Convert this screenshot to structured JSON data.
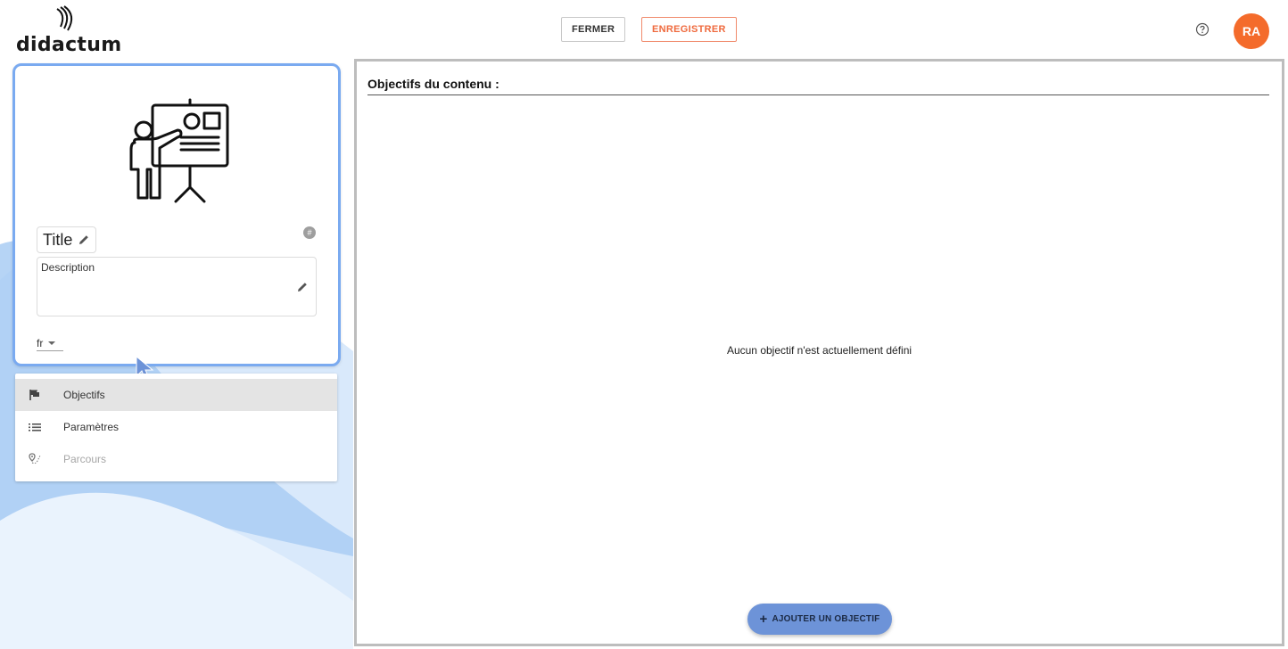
{
  "header": {
    "logo_text": "didactum",
    "close_label": "FERMER",
    "save_label": "ENREGISTRER",
    "avatar_initials": "RA"
  },
  "card": {
    "title": "Title",
    "description_label": "Description",
    "language": "fr",
    "id_badge": "#"
  },
  "nav": {
    "items": [
      {
        "label": "Objectifs",
        "icon": "flag-icon",
        "state": "active"
      },
      {
        "label": "Paramètres",
        "icon": "list-icon",
        "state": "enabled"
      },
      {
        "label": "Parcours",
        "icon": "route-icon",
        "state": "disabled"
      }
    ]
  },
  "main": {
    "section_title": "Objectifs du contenu :",
    "empty_message": "Aucun objectif n'est actuellement défini",
    "add_button_label": "AJOUTER UN OBJECTIF"
  },
  "colors": {
    "accent_orange": "#f46b2b",
    "card_outline": "#7aaaf0",
    "add_button_bg": "#6d93d8"
  }
}
